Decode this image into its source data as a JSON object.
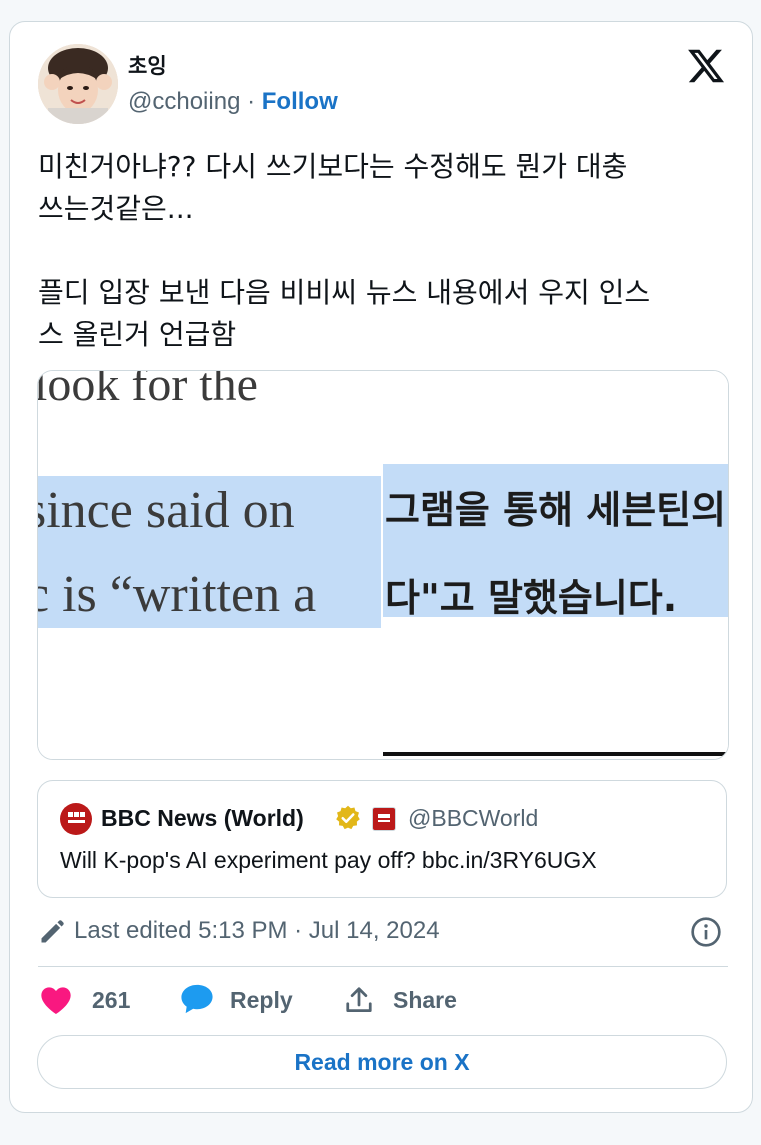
{
  "author": {
    "display_name": "초잉",
    "handle": "@cchoiing",
    "separator": "·",
    "follow_label": "Follow",
    "avatar_icon": "user-avatar-photo"
  },
  "brand_icon": "x-logo-icon",
  "tweet": {
    "text": "미친거아냐?? 다시 쓰기보다는 수정해도 뭔가 대충\n쓰는것같은...\n\n플디 입장 보낸 다음 비비씨 뉴스 내용에서 우지 인스\n스 올린거 언급함"
  },
  "media": {
    "left": {
      "line_top": "look for the",
      "line_mid": "since said on",
      "line_bottom": "c is “written a"
    },
    "right": {
      "line_top": "그램을 통해 세븐틴의",
      "line_bottom": "다\"고 말했습니다."
    },
    "highlight_color": "#c3dcf7"
  },
  "quote": {
    "name": "BBC News (World)",
    "handle": "@BBCWorld",
    "text": "Will K-pop's AI experiment pay off? bbc.in/3RY6UGX",
    "verified_icon": "gold-verified-badge-icon",
    "brand_color": "#bb1919"
  },
  "meta": {
    "edited_text": "Last edited 5:13 PM · Jul 14, 2024"
  },
  "actions": {
    "like_count": "261",
    "reply_label": "Reply",
    "share_label": "Share"
  },
  "read_more_label": "Read more on X",
  "colors": {
    "accent": "#1a73c6",
    "like": "#f91880",
    "reply": "#1d9bf0",
    "muted": "#536471",
    "border": "#cfd9de"
  }
}
